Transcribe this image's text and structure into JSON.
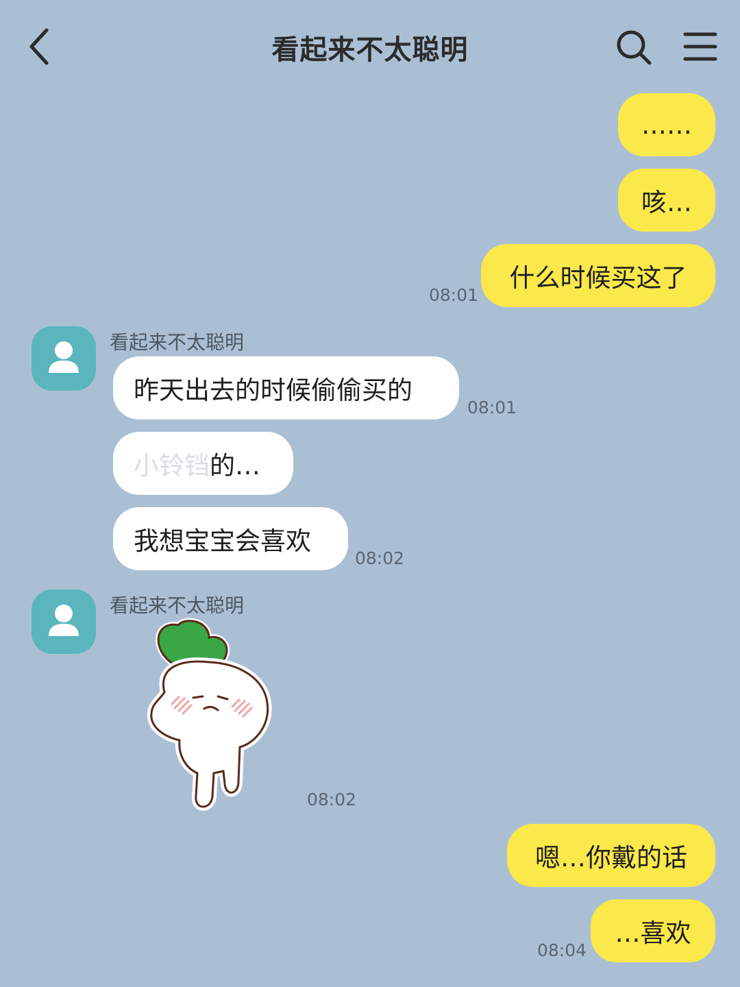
{
  "header": {
    "title": "看起来不太聪明",
    "back_icon": "chevron-left-icon",
    "search_icon": "search-icon",
    "menu_icon": "menu-icon"
  },
  "colors": {
    "background": "#abbfd4",
    "my_bubble": "#fbe84a",
    "their_bubble": "#ffffff",
    "avatar": "#5ab5bd"
  },
  "messages": [
    {
      "from": "me",
      "text": "……"
    },
    {
      "from": "me",
      "text": "咳…"
    },
    {
      "from": "me",
      "text": "什么时候买这了",
      "time": "08:01"
    },
    {
      "from": "other",
      "sender": "看起来不太聪明",
      "text": "昨天出去的时候偷偷买的",
      "time": "08:01"
    },
    {
      "from": "other",
      "text_faded": "小铃铛",
      "text": "的…"
    },
    {
      "from": "other",
      "text": "我想宝宝会喜欢",
      "time": "08:02"
    },
    {
      "from": "other",
      "sender": "看起来不太聪明",
      "sticker": "radish-sticker",
      "time": "08:02"
    },
    {
      "from": "me",
      "text": "嗯…你戴的话"
    },
    {
      "from": "me",
      "text": "…喜欢",
      "time": "08:04"
    }
  ]
}
